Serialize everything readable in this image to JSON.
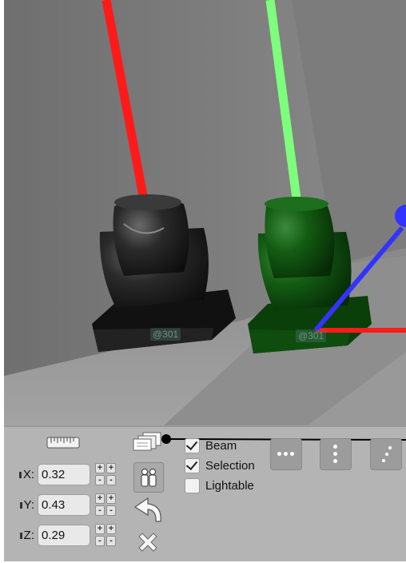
{
  "fixtures": [
    {
      "name": "left-moving-head",
      "tag": "@301"
    },
    {
      "name": "selected-moving-head",
      "tag": "@301"
    }
  ],
  "position": {
    "x": {
      "label": "X:",
      "value": "0.32"
    },
    "y": {
      "label": "Y:",
      "value": "0.43"
    },
    "z": {
      "label": "Z:",
      "value": "0.29"
    }
  },
  "stepper": {
    "plus": "+",
    "minus": "-"
  },
  "options": [
    {
      "label": "Beam",
      "checked": true
    },
    {
      "label": "Selection",
      "checked": true
    },
    {
      "label": "Lightable",
      "checked": false
    }
  ],
  "icons": {
    "measure": "ruler-icon",
    "copy": "copy-layers-icon",
    "people": "people-icon",
    "undo": "undo-arrow-icon",
    "delete": "delete-x-icon",
    "view_horizontal": "three-dots-horizontal-icon",
    "view_vertical": "three-dots-vertical-icon",
    "view_diagonal": "three-dots-diagonal-icon"
  },
  "colors": {
    "axis_x": "#ff1a1a",
    "axis_y": "#7dff7d",
    "axis_z": "#3333ff",
    "selected_fixture": "#0f5a12",
    "panel_bg": "#b4b4b4"
  }
}
